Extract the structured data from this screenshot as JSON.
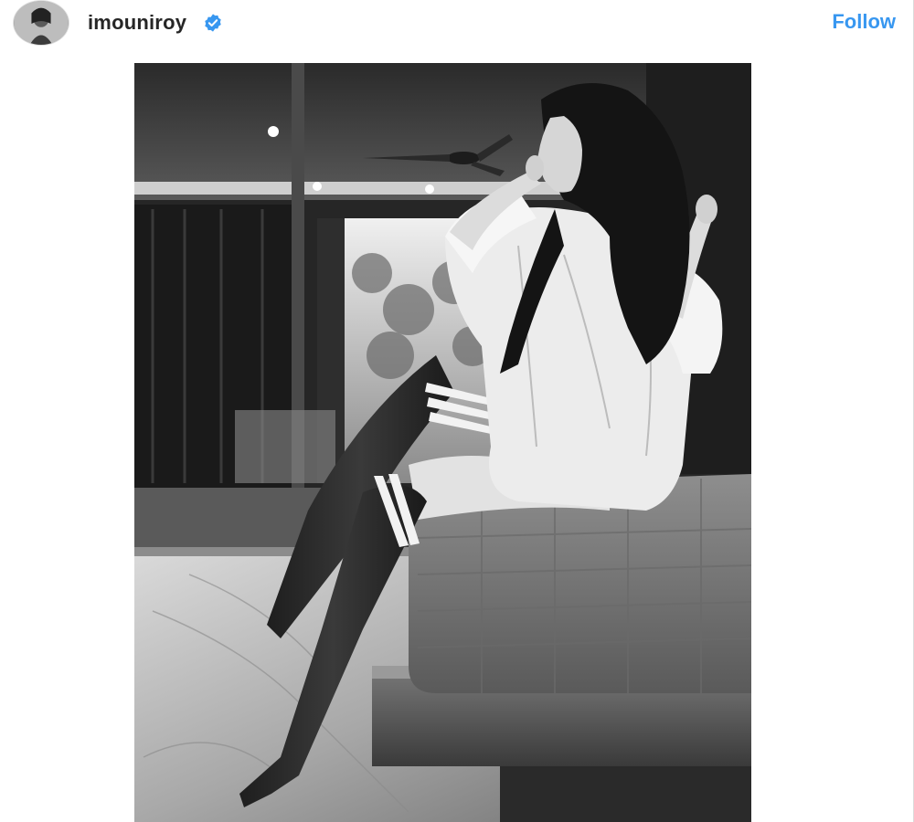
{
  "header": {
    "username": "imouniroy",
    "verified_icon": "verified-badge-icon",
    "follow_label": "Follow"
  },
  "post": {
    "avatar_icon": "profile-avatar",
    "photo_description_icon": "post-photo"
  },
  "colors": {
    "follow": "#3897f0",
    "verified": "#3897f0",
    "username": "#262626"
  }
}
